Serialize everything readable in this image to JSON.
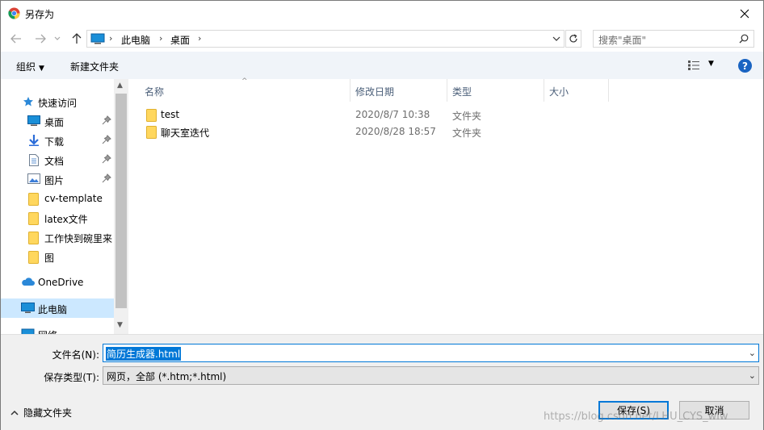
{
  "window": {
    "title": "另存为",
    "close_icon": "close-icon"
  },
  "address_bar": {
    "segments": [
      "此电脑",
      "桌面"
    ],
    "search_placeholder": "搜索\"桌面\""
  },
  "toolbar": {
    "organize_label": "组织",
    "new_folder_label": "新建文件夹"
  },
  "nav_pane": {
    "quick_access": "快速访问",
    "items": [
      {
        "label": "桌面",
        "icon": "desktop-icon",
        "pinned": true
      },
      {
        "label": "下载",
        "icon": "download-icon",
        "pinned": true
      },
      {
        "label": "文档",
        "icon": "document-icon",
        "pinned": true
      },
      {
        "label": "图片",
        "icon": "pictures-icon",
        "pinned": true
      },
      {
        "label": "cv-template",
        "icon": "folder-icon",
        "pinned": false
      },
      {
        "label": "latex文件",
        "icon": "folder-icon",
        "pinned": false
      },
      {
        "label": "工作快到碗里来",
        "icon": "folder-icon",
        "pinned": false
      },
      {
        "label": "图",
        "icon": "folder-icon",
        "pinned": false
      }
    ],
    "onedrive": "OneDrive",
    "this_pc": "此电脑",
    "network": "网络"
  },
  "file_list": {
    "columns": [
      "名称",
      "修改日期",
      "类型",
      "大小"
    ],
    "rows": [
      {
        "name": "test",
        "date": "2020/8/7 10:38",
        "type": "文件夹"
      },
      {
        "name": "聊天室迭代",
        "date": "2020/8/28 18:57",
        "type": "文件夹"
      }
    ]
  },
  "save_form": {
    "filename_label": "文件名(N):",
    "filename_value": "简历生成器.html",
    "type_label": "保存类型(T):",
    "type_value": "网页，全部 (*.htm;*.html)"
  },
  "footer": {
    "hide_folders_label": "隐藏文件夹",
    "save_button": "保存(S)",
    "cancel_button": "取消",
    "watermark": "https://blog.csdn.net/LHU_CYS_wlw"
  },
  "colors": {
    "accent": "#0078d7",
    "selected_nav": "#cce8ff",
    "folder": "#ffd75e"
  }
}
